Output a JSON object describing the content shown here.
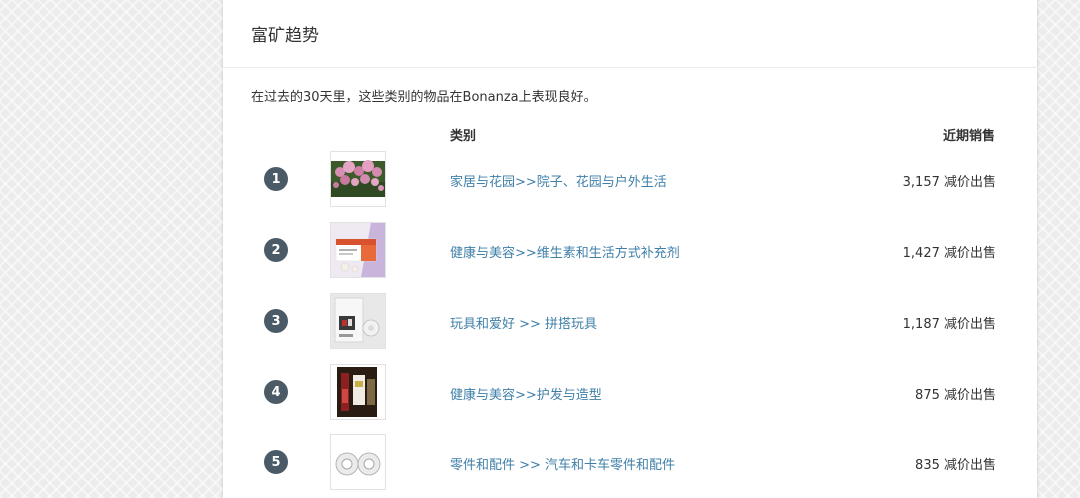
{
  "panel": {
    "title": "富矿趋势",
    "intro": "在过去的30天里，这些类别的物品在Bonanza上表现良好。",
    "columns": {
      "category": "类别",
      "sales": "近期销售"
    },
    "rows": [
      {
        "rank": "1",
        "category": "家居与花园>>院子、花园与户外生活",
        "sales": "3,157 减价出售",
        "thumb": "flower-photo"
      },
      {
        "rank": "2",
        "category": "健康与美容>>维生素和生活方式补充剂",
        "sales": "1,427 减价出售",
        "thumb": "supplement-box-photo"
      },
      {
        "rank": "3",
        "category": "玩具和爱好 >> 拼搭玩具",
        "sales": "1,187 减价出售",
        "thumb": "toy-package-photo"
      },
      {
        "rank": "4",
        "category": "健康与美容>>护发与造型",
        "sales": "875 减价出售",
        "thumb": "hair-product-photo"
      },
      {
        "rank": "5",
        "category": "零件和配件 >> 汽车和卡车零件和配件",
        "sales": "835 减价出售",
        "thumb": "car-parts-photo"
      }
    ]
  },
  "colors": {
    "link": "#3f7fa8",
    "rank_badge": "#4a5a66",
    "text": "#333333"
  }
}
